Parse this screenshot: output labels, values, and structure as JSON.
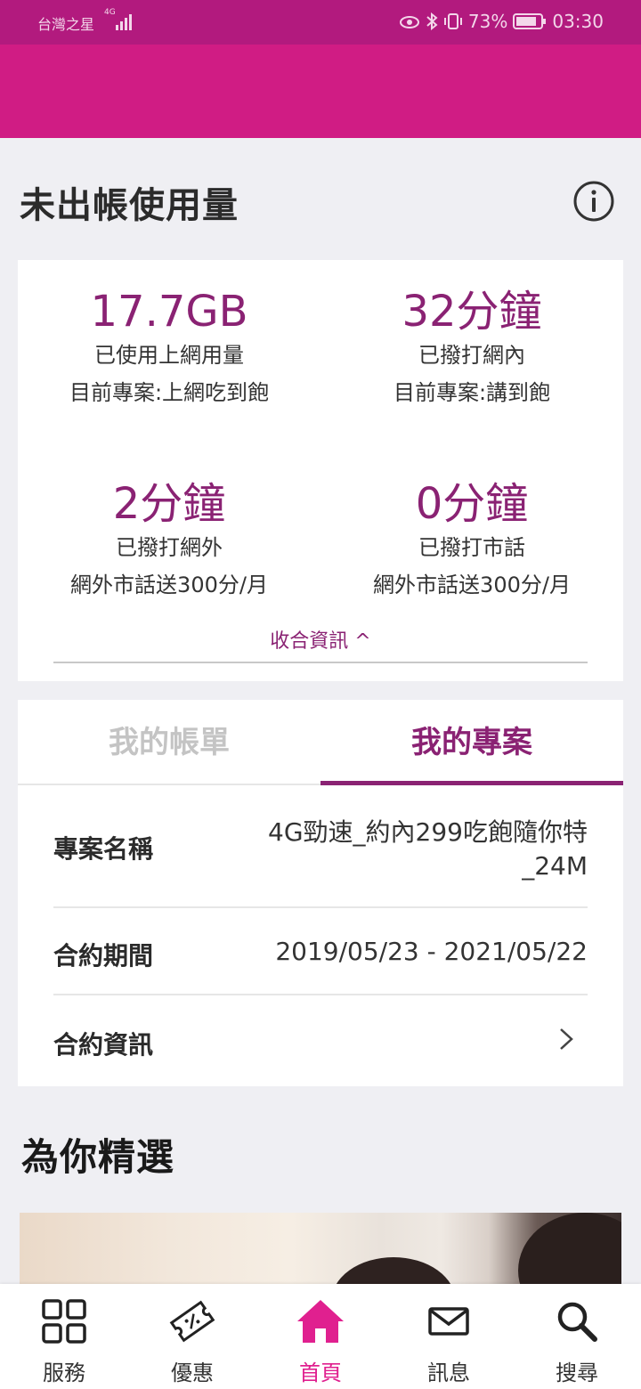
{
  "status_bar": {
    "carrier": "台灣之星",
    "network": "4G",
    "battery": "73%",
    "time": "03:30"
  },
  "usage": {
    "title": "未出帳使用量",
    "items": [
      {
        "value": "17.7GB",
        "label": "已使用上網用量",
        "plan": "目前專案:上網吃到飽"
      },
      {
        "value": "32分鐘",
        "label": "已撥打網內",
        "plan": "目前專案:講到飽"
      },
      {
        "value": "2分鐘",
        "label": "已撥打網外",
        "plan": "網外市話送300分/月"
      },
      {
        "value": "0分鐘",
        "label": "已撥打市話",
        "plan": "網外市話送300分/月"
      }
    ],
    "collapse_label": "收合資訊 ^"
  },
  "tabs": {
    "bill": "我的帳單",
    "plan": "我的專案"
  },
  "plan_details": {
    "name_label": "專案名稱",
    "name_value_line1": "4G勁速_約內299吃飽隨你特",
    "name_value_line2": "_24M",
    "period_label": "合約期間",
    "period_value": "2019/05/23 - 2021/05/22",
    "contract_label": "合約資訊"
  },
  "picks": {
    "title": "為你精選"
  },
  "nav": {
    "items": [
      {
        "label": "服務",
        "icon": "grid-icon"
      },
      {
        "label": "優惠",
        "icon": "coupon-icon"
      },
      {
        "label": "首頁",
        "icon": "home-icon"
      },
      {
        "label": "訊息",
        "icon": "mail-icon"
      },
      {
        "label": "搜尋",
        "icon": "search-icon"
      }
    ],
    "active": "首頁"
  },
  "colors": {
    "brand": "#d01c84",
    "status_bar": "#b21a7e",
    "accent": "#8a2273",
    "nav_active": "#e0208f"
  }
}
